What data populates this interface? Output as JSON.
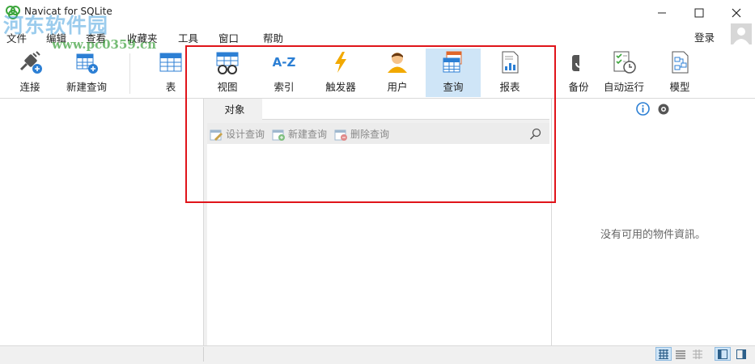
{
  "window": {
    "title": "Navicat for SQLite",
    "controls": [
      "minimize",
      "maximize",
      "close"
    ]
  },
  "watermark": {
    "line1": "河东软件园",
    "line2": "www.pc0359.cn"
  },
  "menubar": {
    "items": [
      {
        "label": "文件"
      },
      {
        "label": "编辑"
      },
      {
        "label": "查看"
      },
      {
        "label": "收藏夹"
      },
      {
        "label": "工具"
      },
      {
        "label": "窗口"
      },
      {
        "label": "帮助"
      }
    ],
    "login_label": "登录"
  },
  "toolbar": {
    "items": [
      {
        "label": "连接",
        "icon": "plug-icon"
      },
      {
        "label": "新建查询",
        "icon": "new-query-icon"
      },
      {
        "label": "表",
        "icon": "table-icon"
      },
      {
        "label": "视图",
        "icon": "view-icon"
      },
      {
        "label": "索引",
        "icon": "index-icon",
        "glyph": "A-Z"
      },
      {
        "label": "触发器",
        "icon": "trigger-icon"
      },
      {
        "label": "用户",
        "icon": "user-icon"
      },
      {
        "label": "查询",
        "icon": "query-icon",
        "active": true
      },
      {
        "label": "报表",
        "icon": "report-icon"
      },
      {
        "label": "备份",
        "icon": "backup-icon"
      },
      {
        "label": "自动运行",
        "icon": "automation-icon"
      },
      {
        "label": "模型",
        "icon": "model-icon"
      }
    ],
    "highlight_color": "#e0141a",
    "active_color": "#cfe5f7"
  },
  "object_panel": {
    "tab_label": "对象",
    "actions": [
      {
        "label": "设计查询",
        "icon": "design-query-icon"
      },
      {
        "label": "新建查询",
        "icon": "new-query-icon"
      },
      {
        "label": "删除查询",
        "icon": "delete-query-icon"
      }
    ],
    "search_icon": "search-icon"
  },
  "info_panel": {
    "message": "没有可用的物件資訊。",
    "icons": [
      "info-icon",
      "eye-icon"
    ]
  },
  "statusbar": {
    "view_buttons": [
      "grid-view-icon",
      "list-view-icon",
      "detail-view-icon"
    ],
    "layout_buttons": [
      "left-pane-icon",
      "right-pane-icon"
    ]
  }
}
